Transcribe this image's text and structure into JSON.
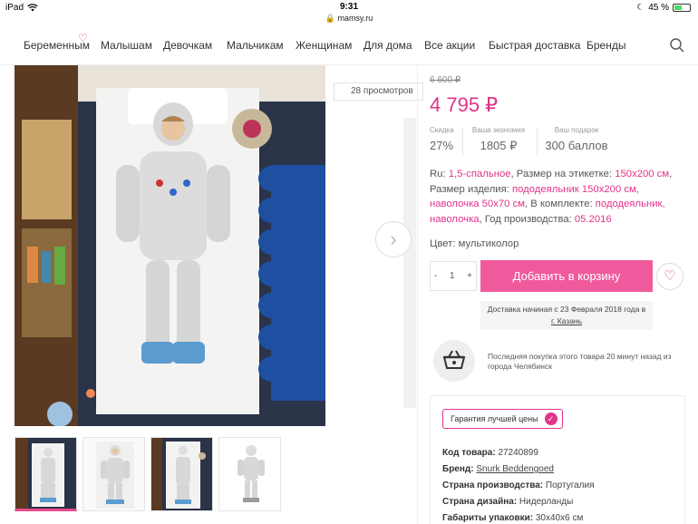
{
  "status_bar": {
    "device": "iPad",
    "time": "9:31",
    "url": "mamsy.ru",
    "battery": "45 %",
    "battery_level": 0.45
  },
  "nav": {
    "items": [
      "Беременным",
      "Малышам",
      "Девочкам",
      "Мальчикам",
      "Женщинам",
      "Для дома",
      "Все акции",
      "Быстрая доставка",
      "Бренды"
    ],
    "search_icon": "search-icon"
  },
  "gallery": {
    "views": "28 просмотров",
    "next_icon": "chevron-right-icon",
    "thumbnails": 4,
    "active_thumbnail": 1
  },
  "product": {
    "old_price": "6 600 ₽",
    "price": "4 795 ₽",
    "stats": [
      {
        "label": "Скидка",
        "value": "27%"
      },
      {
        "label": "Ваша экономия",
        "value": "1805 ₽"
      },
      {
        "label": "Ваш подарок",
        "value": "300 баллов"
      }
    ],
    "desc": {
      "ru_label": "Ru: ",
      "ru_value": "1,5-спальное",
      "label_size_label": ", Размер на этикетке: ",
      "label_size_value": "150x200 см",
      "item_size_label": ", Размер изделия: ",
      "item_size_value": "пододеяльник 150x200 см, наволочка 50x70 см",
      "set_label": ", В комплекте: ",
      "set_value": "пододеяльник, наволочка",
      "year_label": ", Год производства: ",
      "year_value": "05.2016"
    },
    "color": "Цвет: мультиколор",
    "qty": {
      "minus": "-",
      "value": "1",
      "plus": "+"
    },
    "add_to_cart": "Добавить в корзину",
    "delivery_text": "Доставка начиная с 23 Февраля 2018 года в",
    "delivery_city": "г. Казань",
    "last_purchase": "Последняя покупка этого товара 20 минут назад из города Челябинск",
    "guarantee": "Гарантия лучшей цены",
    "specs": [
      {
        "label": "Код товара: ",
        "value": "27240899",
        "link": false
      },
      {
        "label": "Бренд: ",
        "value": "Snurk Beddengoed",
        "link": true
      },
      {
        "label": "Страна производства: ",
        "value": "Португалия",
        "link": false
      },
      {
        "label": "Страна дизайна: ",
        "value": "Нидерланды",
        "link": false
      },
      {
        "label": "Габариты упаковки: ",
        "value": "30x40x6 см",
        "link": false
      }
    ]
  },
  "colors": {
    "accent": "#e2338a",
    "button": "#f05a9d"
  }
}
